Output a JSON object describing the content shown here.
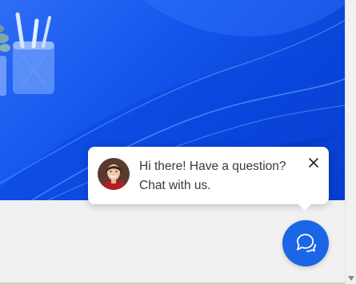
{
  "chat_widget": {
    "greeting_line1": "Hi there! Have a question?",
    "greeting_line2": "Chat with us.",
    "close_icon": "close-icon",
    "launcher_icon": "chat-bubble-icon",
    "accent_color": "#1a66e6"
  },
  "hero": {
    "background_color": "#1558ee"
  }
}
